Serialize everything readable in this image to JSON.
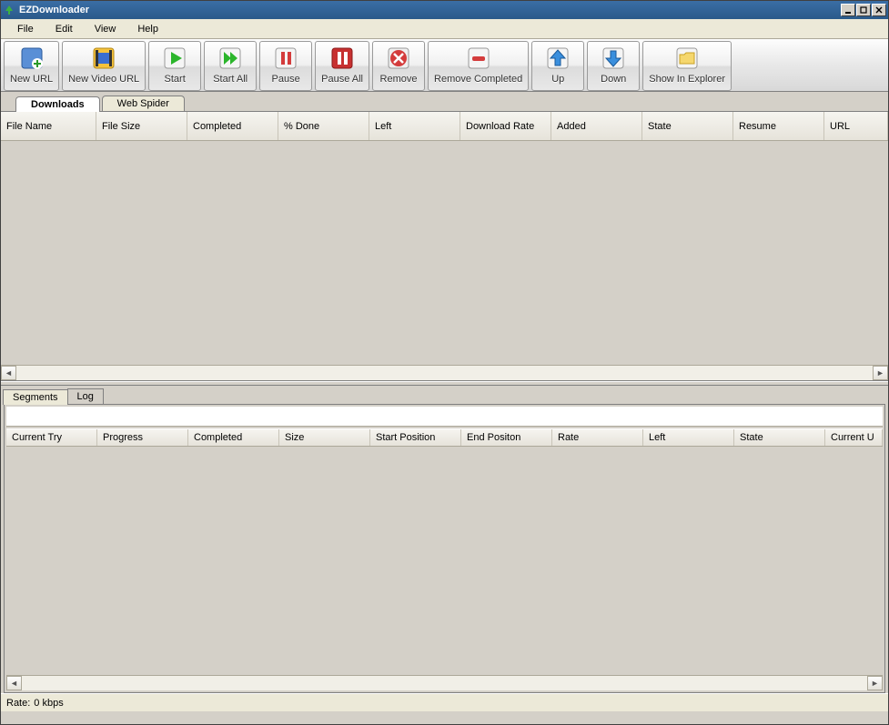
{
  "window": {
    "title": "EZDownloader",
    "icon": "app-icon"
  },
  "menu": {
    "file": "File",
    "edit": "Edit",
    "view": "View",
    "help": "Help"
  },
  "toolbar": {
    "new_url": "New URL",
    "new_video_url": "New Video URL",
    "start": "Start",
    "start_all": "Start All",
    "pause": "Pause",
    "pause_all": "Pause All",
    "remove": "Remove",
    "remove_completed": "Remove Completed",
    "up": "Up",
    "down": "Down",
    "show_in_explorer": "Show In Explorer"
  },
  "tabs": {
    "downloads": "Downloads",
    "web_spider": "Web Spider"
  },
  "columns": {
    "file_name": "File Name",
    "file_size": "File Size",
    "completed": "Completed",
    "pct_done": "% Done",
    "left": "Left",
    "download_rate": "Download Rate",
    "added": "Added",
    "state": "State",
    "resume": "Resume",
    "url": "URL"
  },
  "bottom_tabs": {
    "segments": "Segments",
    "log": "Log"
  },
  "segment_columns": {
    "current_try": "Current Try",
    "progress": "Progress",
    "completed": "Completed",
    "size": "Size",
    "start_position": "Start Position",
    "end_position": "End Positon",
    "rate": "Rate",
    "left": "Left",
    "state": "State",
    "current_u": "Current U"
  },
  "status": {
    "rate_label": "Rate:",
    "rate_value": "0 kbps"
  }
}
